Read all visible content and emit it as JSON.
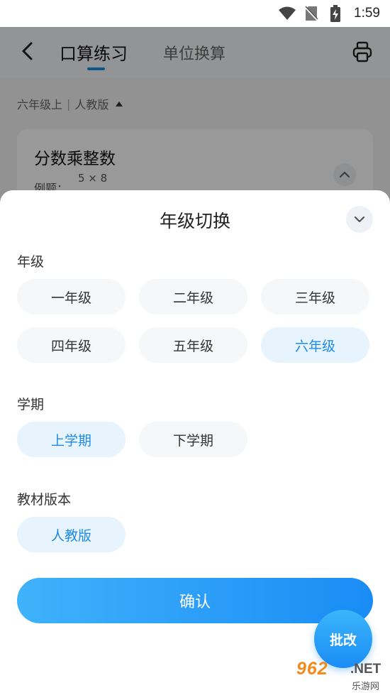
{
  "status_bar": {
    "time": "1:59"
  },
  "header": {
    "tabs": [
      {
        "label": "口算练习",
        "active": true
      },
      {
        "label": "单位换算",
        "active": false
      }
    ]
  },
  "background": {
    "subheader": {
      "grade": "六年级上",
      "edition": "人教版"
    },
    "card": {
      "title": "分数乘整数",
      "example_label": "例题：",
      "example_expr": "5 × 8"
    }
  },
  "sheet": {
    "title": "年级切换",
    "sections": {
      "grade": {
        "label": "年级",
        "options": [
          "一年级",
          "二年级",
          "三年级",
          "四年级",
          "五年级",
          "六年级"
        ],
        "selected": "六年级"
      },
      "term": {
        "label": "学期",
        "options": [
          "上学期",
          "下学期"
        ],
        "selected": "上学期"
      },
      "edition": {
        "label": "教材版本",
        "options": [
          "人教版"
        ],
        "selected": "人教版"
      }
    },
    "confirm_label": "确认"
  },
  "fab": {
    "label": "批改"
  },
  "watermark": {
    "brand": "962",
    "tld": ".NET",
    "sub": "乐游网"
  },
  "colors": {
    "accent": "#1a8cf5",
    "selected_bg": "#e7f3fd",
    "chip_bg": "#f6f7f9"
  }
}
